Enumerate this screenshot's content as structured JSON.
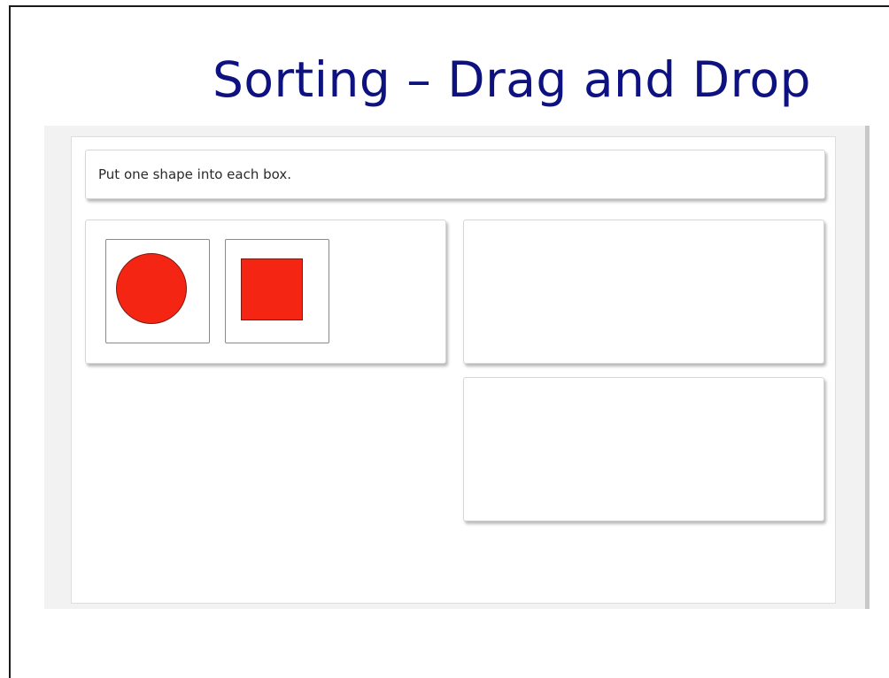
{
  "slide": {
    "title": "Sorting – Drag and Drop"
  },
  "activity": {
    "instruction": "Put one shape into each box.",
    "source_items": [
      {
        "shape": "circle",
        "icon": "circle-shape-icon",
        "color": "#f52514"
      },
      {
        "shape": "square",
        "icon": "square-shape-icon",
        "color": "#f52514"
      }
    ],
    "drop_zones": [
      {
        "items": []
      },
      {
        "items": []
      }
    ]
  },
  "colors": {
    "title": "#0e1280",
    "shape_fill": "#f52514",
    "embed_background": "#f2f2f2"
  }
}
